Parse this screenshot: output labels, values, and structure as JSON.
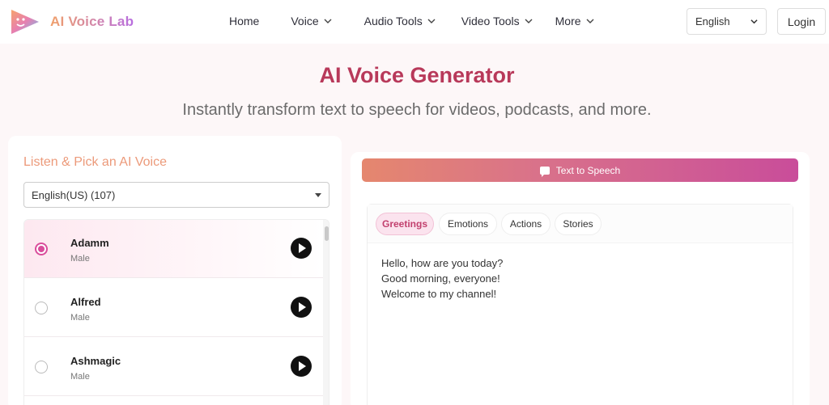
{
  "nav": {
    "logo_text": "AI Voice Lab",
    "links": [
      {
        "label": "Home",
        "has_dropdown": false
      },
      {
        "label": "Voice",
        "has_dropdown": true
      },
      {
        "label": "Audio Tools",
        "has_dropdown": true
      },
      {
        "label": "Video Tools",
        "has_dropdown": true
      },
      {
        "label": "More",
        "has_dropdown": true
      }
    ],
    "language": "English",
    "login_label": "Login"
  },
  "hero": {
    "title": "AI Voice Generator",
    "subtitle": "Instantly transform text to speech for videos, podcasts, and more."
  },
  "voice_picker": {
    "heading": "Listen & Pick an AI Voice",
    "language_filter": "English(US) (107)",
    "voices": [
      {
        "name": "Adamm",
        "gender": "Male",
        "selected": true
      },
      {
        "name": "Alfred",
        "gender": "Male",
        "selected": false
      },
      {
        "name": "Ashmagic",
        "gender": "Male",
        "selected": false
      }
    ]
  },
  "tts": {
    "button_label": "Text to Speech",
    "tabs": [
      {
        "label": "Greetings",
        "active": true
      },
      {
        "label": "Emotions",
        "active": false
      },
      {
        "label": "Actions",
        "active": false
      },
      {
        "label": "Stories",
        "active": false
      }
    ],
    "text_lines": [
      "Hello, how are you today?",
      "Good morning, everyone!",
      "Welcome to my channel!"
    ]
  },
  "colors": {
    "brand": "#b8395a",
    "accent_pink": "#d94d9b",
    "heading_orange": "#ec9a7a"
  }
}
